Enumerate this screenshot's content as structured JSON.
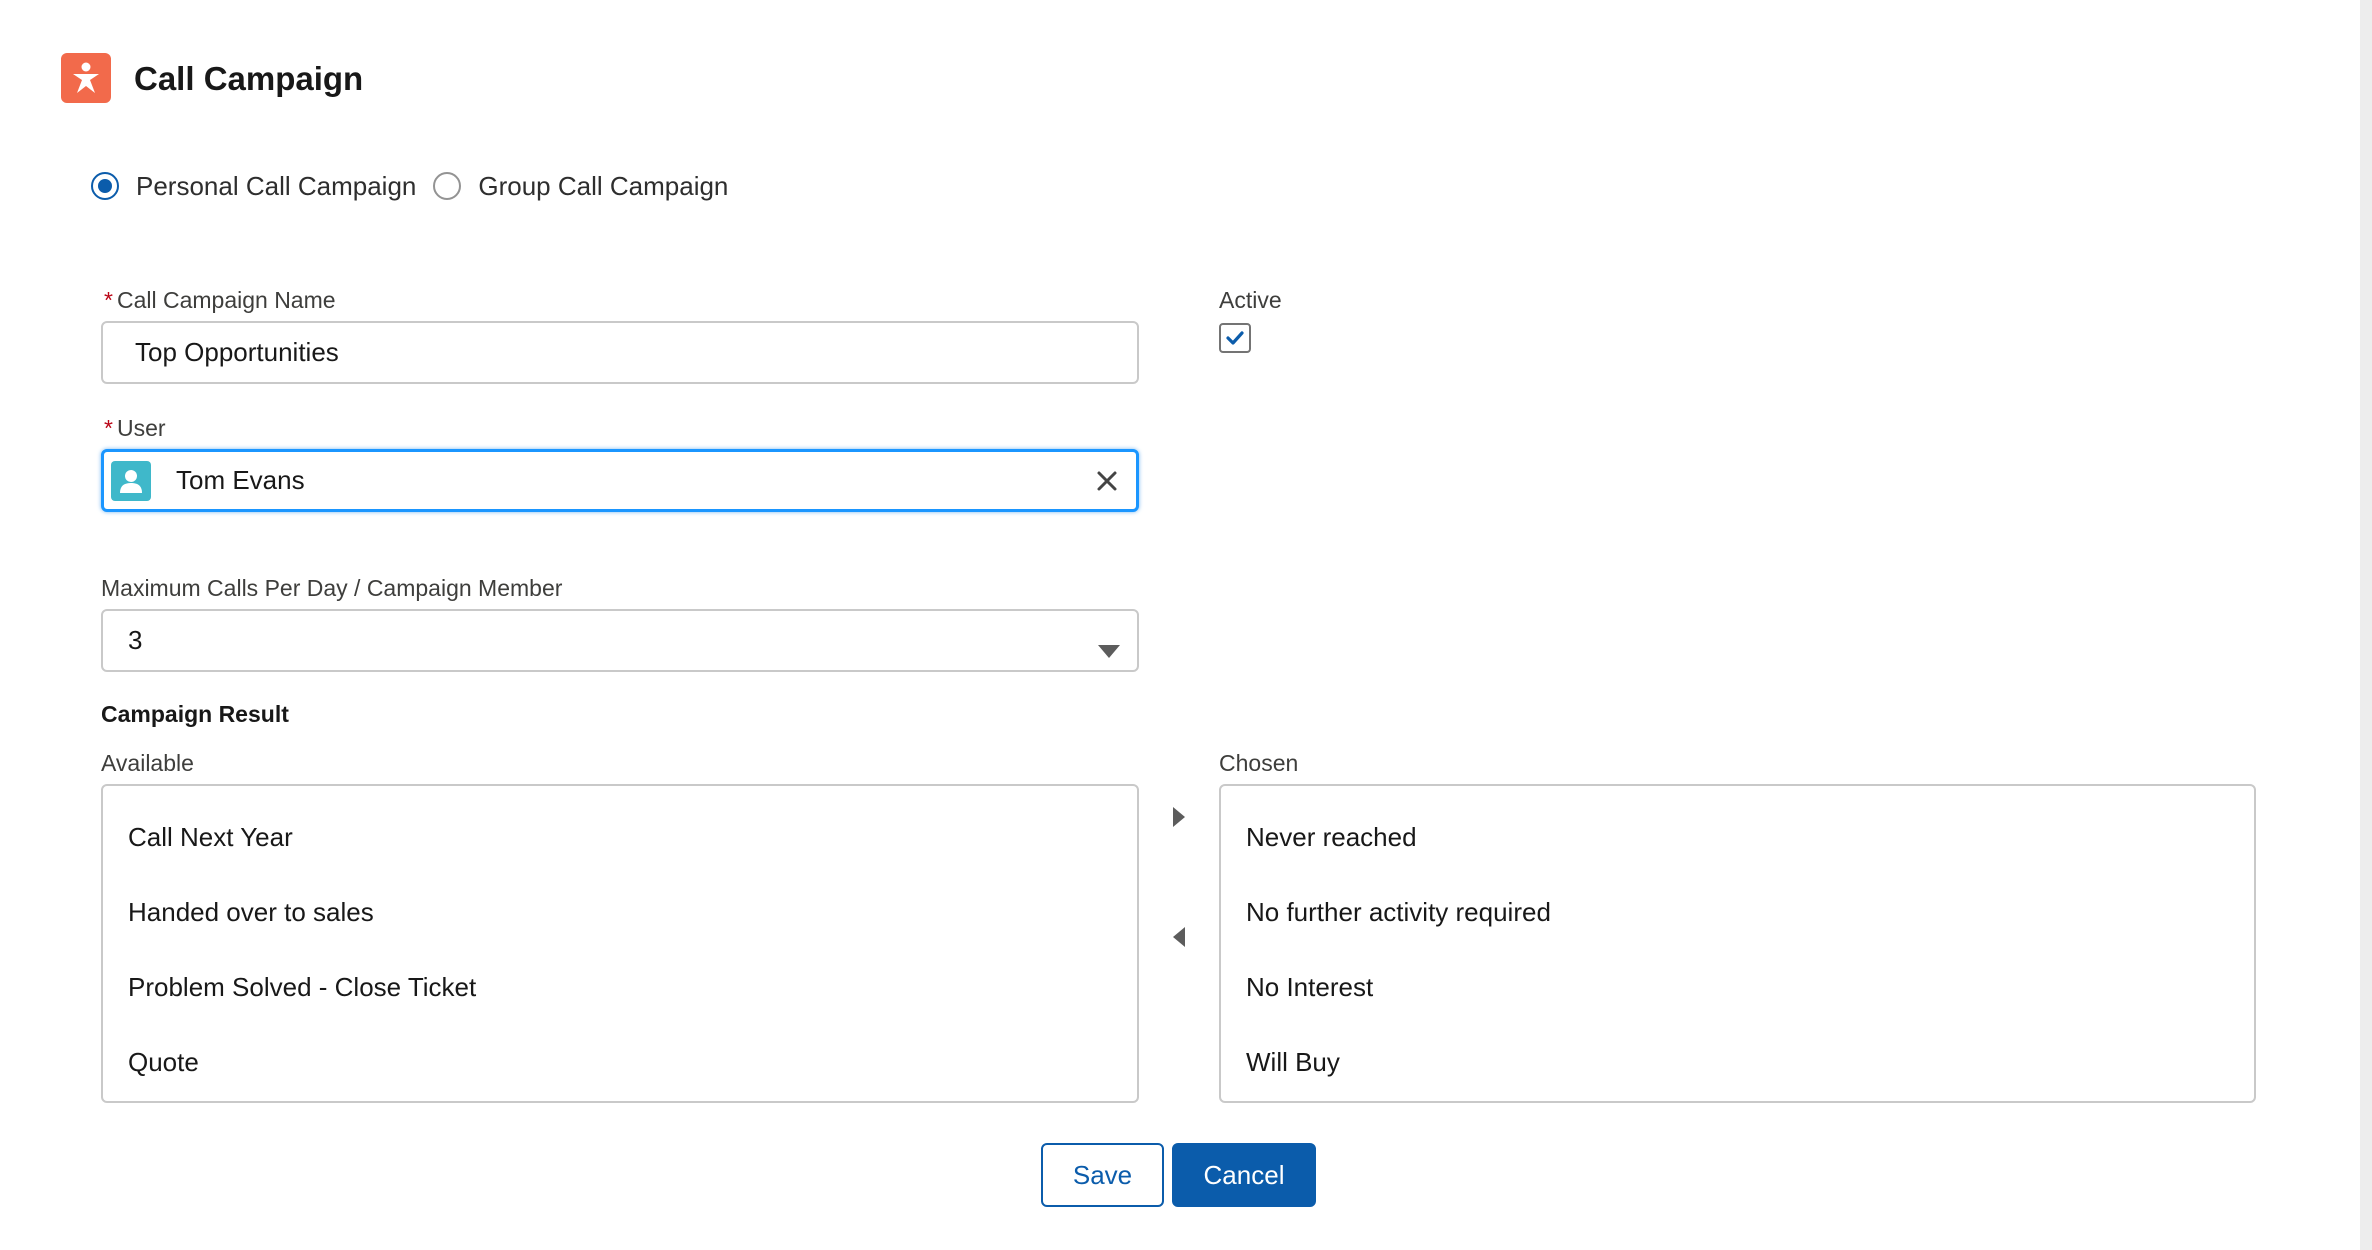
{
  "header": {
    "title": "Call Campaign",
    "icon": "person-star-icon",
    "icon_color": "#f26a4b"
  },
  "campaign_type": {
    "options": [
      {
        "label": "Personal Call Campaign",
        "selected": true
      },
      {
        "label": "Group Call Campaign",
        "selected": false
      }
    ]
  },
  "form": {
    "name": {
      "required_mark": "*",
      "label": "Call Campaign Name",
      "value": "Top Opportunities"
    },
    "active": {
      "label": "Active",
      "checked": true
    },
    "user": {
      "required_mark": "*",
      "label": "User",
      "value": "Tom Evans"
    },
    "max_calls": {
      "label": "Maximum Calls Per Day / Campaign Member",
      "value": "3"
    }
  },
  "campaign_result": {
    "title": "Campaign Result",
    "available_label": "Available",
    "chosen_label": "Chosen",
    "available": [
      "Call Next Year",
      "Handed over to sales",
      "Problem Solved - Close Ticket",
      "Quote"
    ],
    "chosen": [
      "Never reached",
      "No further activity required",
      "No Interest",
      "Will Buy"
    ]
  },
  "actions": {
    "save_label": "Save",
    "cancel_label": "Cancel"
  },
  "colors": {
    "brand_blue": "#0b5cab",
    "focus_blue": "#1b96ff",
    "required_red": "#ba0517",
    "avatar_teal": "#3fb8ca"
  }
}
